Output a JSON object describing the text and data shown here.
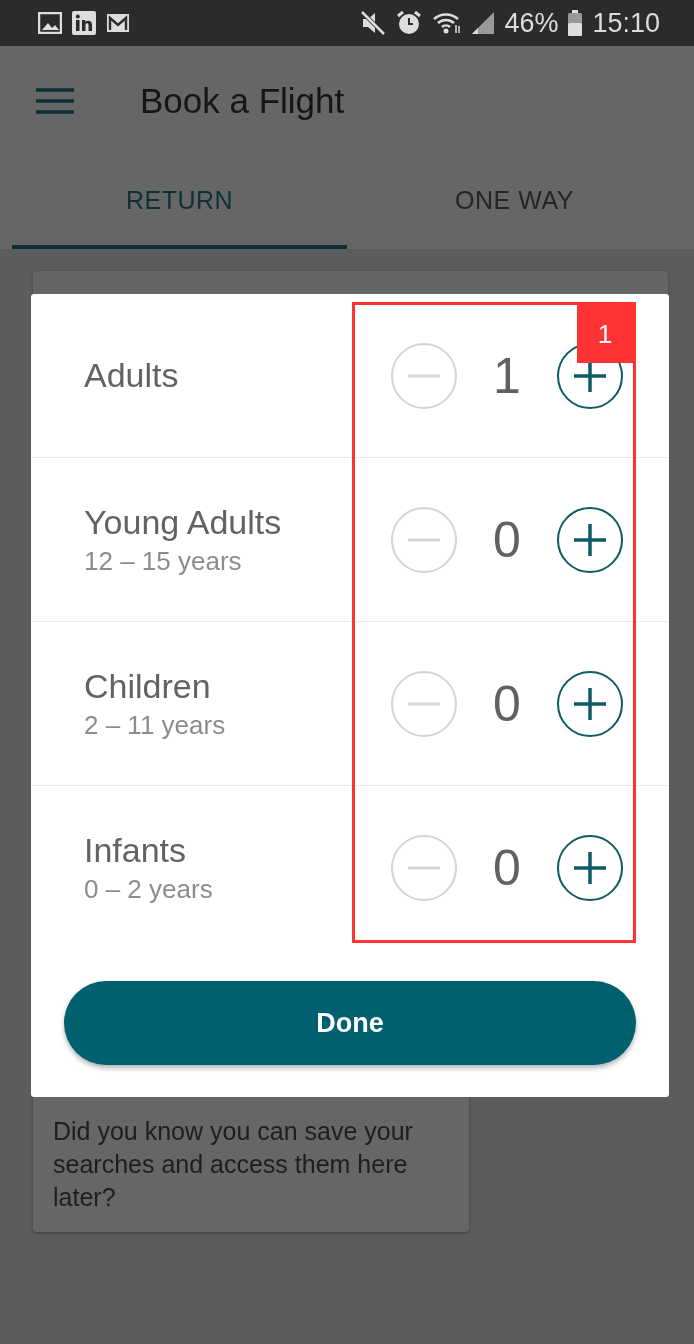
{
  "status_bar": {
    "battery": "46%",
    "time": "15:10"
  },
  "app_bar": {
    "title": "Book a Flight"
  },
  "tabs": [
    {
      "label": "RETURN",
      "selected": true
    },
    {
      "label": "ONE WAY",
      "selected": false
    }
  ],
  "dialog": {
    "rows": [
      {
        "label": "Adults",
        "count": "1",
        "decrement_disabled": true
      },
      {
        "label": "Young Adults",
        "sublabel": "12 – 15 years",
        "count": "0",
        "decrement_disabled": true
      },
      {
        "label": "Children",
        "sublabel": "2 – 11 years",
        "count": "0",
        "decrement_disabled": true
      },
      {
        "label": "Infants",
        "sublabel": "0 – 2 years",
        "count": "0",
        "decrement_disabled": true
      }
    ],
    "done_button": "Done"
  },
  "tip_card": {
    "text": "Did you know you can save your searches and access them here later?"
  },
  "annotation": {
    "label": "1"
  }
}
